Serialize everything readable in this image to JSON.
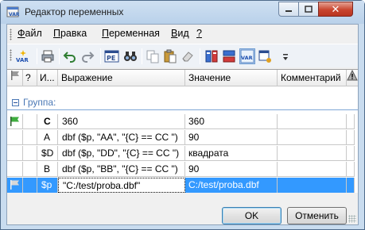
{
  "window": {
    "title": "Редактор переменных"
  },
  "menu": {
    "items": [
      {
        "label": "Файл"
      },
      {
        "label": "Правка"
      },
      {
        "label": "Переменная"
      },
      {
        "label": "Вид"
      },
      {
        "label": "?"
      }
    ]
  },
  "toolbar": {
    "var_label": "VAR",
    "pe_label": "PE"
  },
  "grid": {
    "columns": {
      "flag": "",
      "mark": "?",
      "name": "И...",
      "expression": "Выражение",
      "value": "Значение",
      "comment": "Комментарий"
    },
    "group_label": "Группа:",
    "rows": [
      {
        "name": "C",
        "expression": "360",
        "value": "360",
        "comment": "",
        "bold": true,
        "flag": "green"
      },
      {
        "name": "A",
        "expression": "dbf ($p, \"AA\", \"{C} == CC \")",
        "value": "90",
        "comment": ""
      },
      {
        "name": "$D",
        "expression": "dbf ($p, \"DD\", \"{C} == CC \")",
        "value": "квадрата",
        "comment": ""
      },
      {
        "name": "B",
        "expression": "dbf ($p, \"BB\", \"{C} == CC \")",
        "value": "90",
        "comment": ""
      },
      {
        "name": "$p",
        "expression": "\"C:/test/proba.dbf\"",
        "value": "C:/test/proba.dbf",
        "comment": "",
        "selected": true,
        "flag": "gray"
      }
    ]
  },
  "buttons": {
    "ok": "OK",
    "cancel": "Отменить"
  },
  "colors": {
    "selection": "#3399ff",
    "group_text": "#4a78b5",
    "titlebar": "#c9dcef"
  }
}
